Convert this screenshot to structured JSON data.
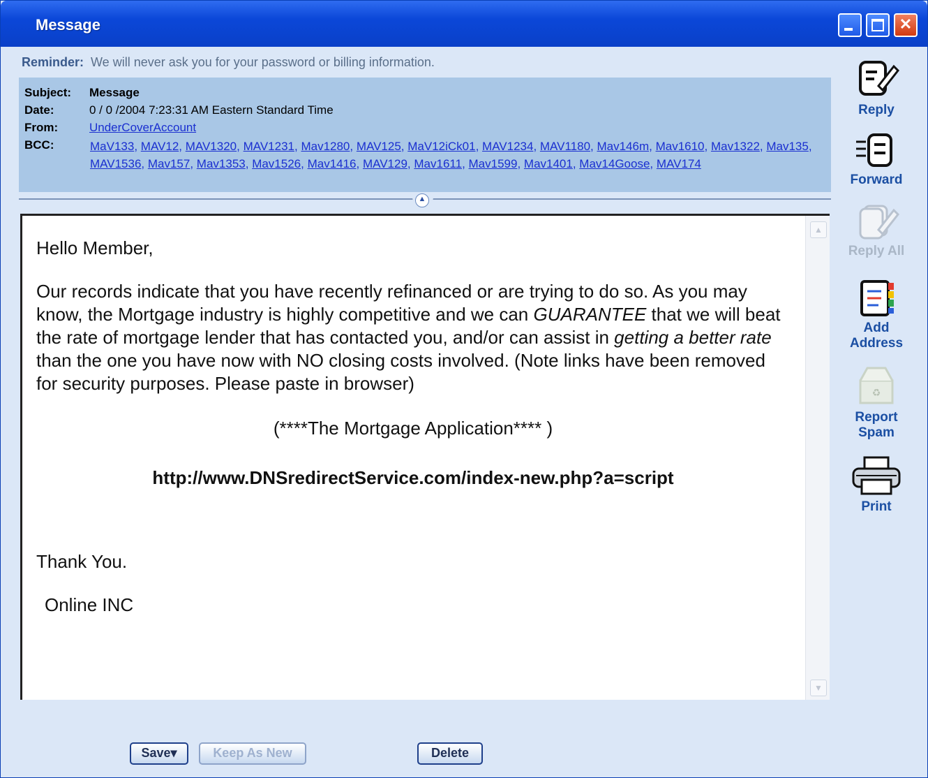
{
  "window": {
    "title": "Message"
  },
  "reminder": {
    "label": "Reminder:",
    "text": "We  will never ask you for your password or billing information."
  },
  "header": {
    "subject": {
      "label": "Subject:",
      "value": "Message"
    },
    "date": {
      "label": "Date:",
      "value": "0 / 0  /2004 7:23:31 AM Eastern Standard Time"
    },
    "from": {
      "label": "From:",
      "value": "UnderCoverAccount"
    },
    "bcc": {
      "label": "BCC:",
      "recipients": [
        "MaV133",
        "MAV12",
        "MAV1320",
        "MAV1231",
        "Mav1280",
        "MAV125",
        "MaV12iCk01",
        "MAV1234",
        "MAV1180",
        "Mav146m",
        "Mav1610",
        "Mav1322",
        "Mav135",
        "MAV1536",
        "Mav157",
        "Mav1353",
        "Mav1526",
        "Mav1416",
        "MAV129",
        "Mav1611",
        "Mav1599",
        "Mav1401",
        "Mav14Goose",
        "MAV174"
      ]
    }
  },
  "message": {
    "greeting": "Hello  Member,",
    "para1": "Our records indicate that you have recently refinanced or are trying to do so. As you may know, the Mortgage industry is highly competitive and we can ",
    "para1_em1": "GUARANTEE",
    "para1_mid": " that we will beat the rate of mortgage lender that has contacted you, and/or can assist in ",
    "para1_em2": "getting a better rate",
    "para1_end": " than the one you have now with NO closing costs involved. (Note links have been removed for security purposes. Please paste in browser)",
    "app_line": "(****The Mortgage Application**** )",
    "url": "http://www.DNSredirectService.com/index-new.php?a=script",
    "thanks": "Thank You.",
    "signature": "Online INC"
  },
  "sidebar": {
    "reply": "Reply",
    "forward": "Forward",
    "reply_all": "Reply All",
    "add_address": "Add Address",
    "report_spam": "Report Spam",
    "print": "Print"
  },
  "footer": {
    "save": "Save▾",
    "keep_as_new": "Keep As New",
    "delete": "Delete"
  },
  "colors": {
    "titlebar": "#0b47d8",
    "header_bg": "#a9c7e6",
    "window_bg": "#dbe7f7",
    "link": "#1a2fd0",
    "sidebar_text": "#1b4fa3"
  }
}
